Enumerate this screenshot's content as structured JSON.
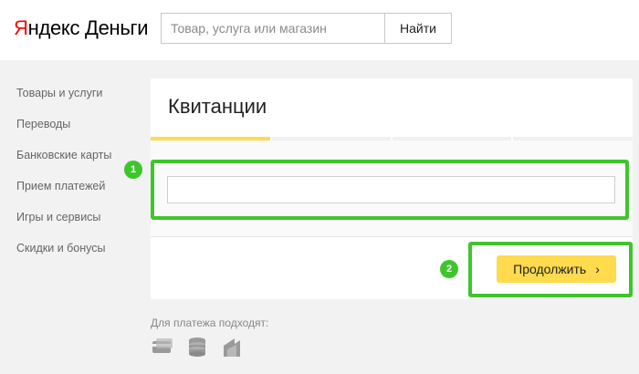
{
  "header": {
    "logo_first_letter": "Я",
    "logo_rest": "ндекс Деньги",
    "search_placeholder": "Товар, услуга или магазин",
    "search_button_label": "Найти"
  },
  "sidebar": {
    "items": [
      {
        "label": "Товары и услуги"
      },
      {
        "label": "Переводы"
      },
      {
        "label": "Банковские карты"
      },
      {
        "label": "Прием платежей"
      },
      {
        "label": "Игры и сервисы"
      },
      {
        "label": "Скидки и бонусы"
      }
    ]
  },
  "main": {
    "title": "Квитанции",
    "progress": {
      "steps": 4,
      "current_step": 1
    },
    "input_value": "",
    "continue_label": "Продолжить",
    "continue_chevron": "›"
  },
  "annotations": {
    "badge_1": "1",
    "badge_2": "2"
  },
  "payment_hint": {
    "text": "Для платежа подходят:",
    "icons": [
      "card-icon",
      "coins-icon",
      "wallet-icon"
    ]
  },
  "colors": {
    "brand_red": "#ff0000",
    "accent_yellow": "#ffdb4d",
    "highlight_green": "#3fc52c"
  }
}
